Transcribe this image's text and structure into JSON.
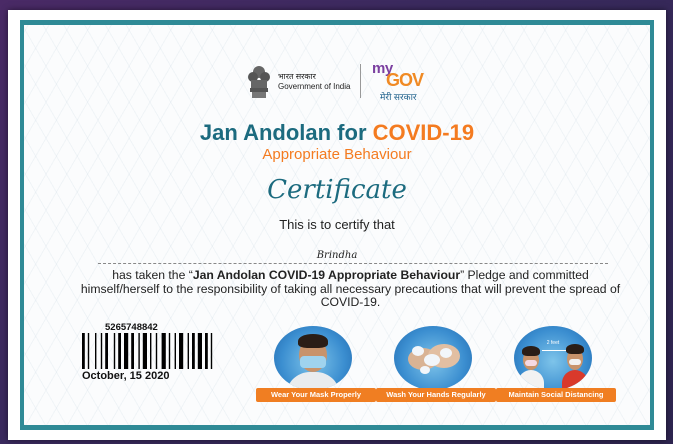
{
  "header": {
    "goi_hindi": "भारत सरकार",
    "goi_english": "Government of India",
    "mygov_my": "my",
    "mygov_gov": "GOV",
    "mygov_hindi": "मेरी सरकार"
  },
  "title": {
    "part1": "Jan Andolan for ",
    "part2": "COVID-19",
    "subtitle": "Appropriate Behaviour"
  },
  "certificate": {
    "heading": "Certificate",
    "certify_line": "This is to certify that",
    "recipient_name": "Brindha",
    "pledge_prefix": "has taken the “",
    "pledge_name": "Jan Andolan COVID-19 Appropriate Behaviour",
    "pledge_suffix": "” Pledge and committed himself/herself to the responsibility of taking all necessary precautions that will prevent the spread of COVID-19.",
    "number": "5265748842",
    "date": "October, 15 2020"
  },
  "tiles": [
    {
      "label": "Wear Your Mask Properly",
      "icon": "mask-person-icon"
    },
    {
      "label": "Wash Your Hands Regularly",
      "icon": "hand-wash-icon"
    },
    {
      "label": "Maintain Social Distancing",
      "icon": "social-distance-icon",
      "distance_text": "2 feet"
    }
  ],
  "colors": {
    "teal": "#1c6b7f",
    "orange": "#f47b20",
    "border": "#2f8a96"
  }
}
